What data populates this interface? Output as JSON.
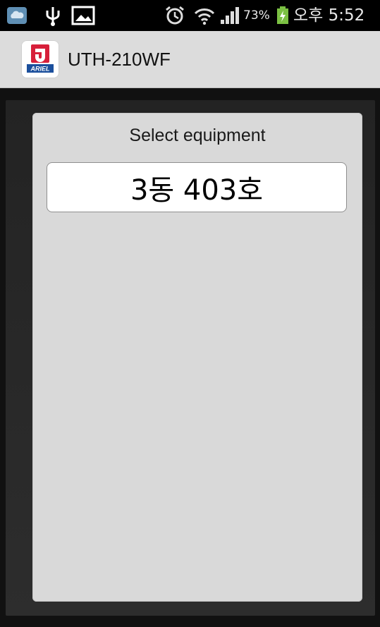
{
  "status_bar": {
    "battery_percent": "73%",
    "time": "오후 5:52",
    "icons": [
      "cloud-icon",
      "usb-icon",
      "image-icon",
      "alarm-icon",
      "wifi-icon",
      "signal-icon",
      "battery-charging-icon"
    ]
  },
  "action_bar": {
    "title": "UTH-210WF",
    "app_icon_brand": "ARIEL"
  },
  "panel": {
    "title": "Select equipment",
    "equipment": [
      {
        "label": "3동 403호"
      }
    ]
  }
}
